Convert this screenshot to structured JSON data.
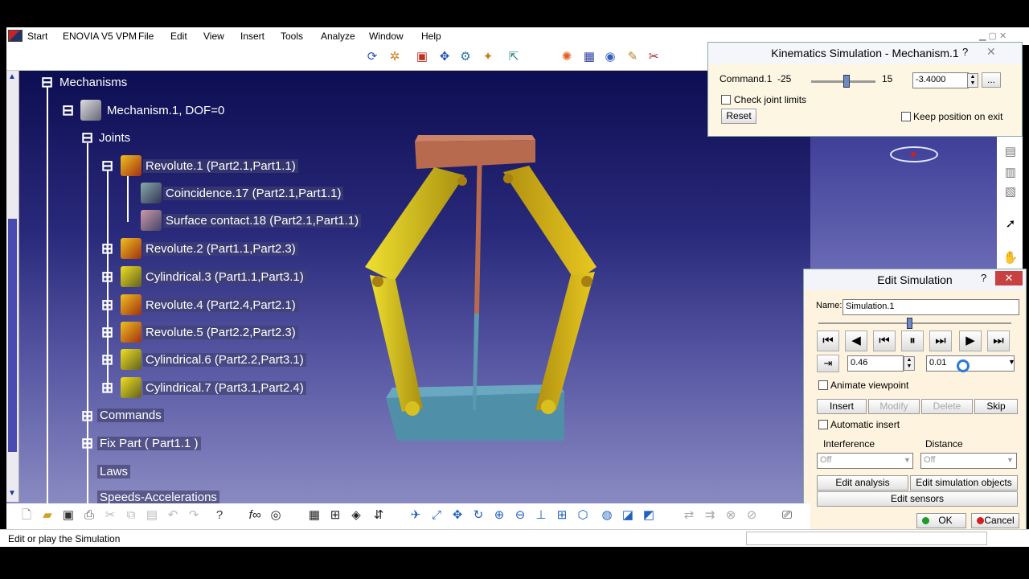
{
  "menu": {
    "start": "Start",
    "items": [
      "ENOVIA V5 VPM",
      "File",
      "Edit",
      "View",
      "Insert",
      "Tools",
      "Analyze",
      "Window",
      "Help"
    ]
  },
  "tree": {
    "root": "Mechanisms",
    "mechanism": "Mechanism.1, DOF=0",
    "joints": "Joints",
    "revolute1": "Revolute.1 (Part2.1,Part1.1)",
    "coincidence": "Coincidence.17 (Part2.1,Part1.1)",
    "surface": "Surface contact.18 (Part2.1,Part1.1)",
    "revolute2": "Revolute.2 (Part1.1,Part2.3)",
    "cyl3": "Cylindrical.3 (Part1.1,Part3.1)",
    "revolute4": "Revolute.4 (Part2.4,Part2.1)",
    "revolute5": "Revolute.5 (Part2.2,Part2.3)",
    "cyl6": "Cylindrical.6 (Part2.2,Part3.1)",
    "cyl7": "Cylindrical.7 (Part3.1,Part2.4)",
    "commands": "Commands",
    "fixpart": "Fix Part ( Part1.1 )",
    "laws": "Laws",
    "speeds": "Speeds-Accelerations"
  },
  "kinematics": {
    "title": "Kinematics Simulation - Mechanism.1",
    "help": "?",
    "close": "✕",
    "command_label": "Command.1",
    "min": "-25",
    "max": "15",
    "value": "-3.4000",
    "more": "...",
    "check_limits": "Check joint limits",
    "reset": "Reset",
    "keep_position": "Keep position on exit"
  },
  "editsim": {
    "title": "Edit Simulation",
    "help": "?",
    "close": "✕",
    "name_label": "Name:",
    "name_value": "Simulation.1",
    "step_value": "0.46",
    "speed_value": "0.01",
    "animate_viewpoint": "Animate viewpoint",
    "insert": "Insert",
    "modify": "Modify",
    "delete": "Delete",
    "skip": "Skip",
    "automatic_insert": "Automatic insert",
    "interference_label": "Interference",
    "interference_value": "Off",
    "distance_label": "Distance",
    "distance_value": "Off",
    "edit_analysis": "Edit analysis",
    "edit_objects": "Edit simulation objects",
    "edit_sensors": "Edit sensors",
    "ok": "OK",
    "cancel": "Cancel"
  },
  "status": {
    "message": "Edit or play the Simulation"
  },
  "colors": {
    "yellow_link": "#d6c21a",
    "base": "#4f8fa8",
    "top_plate": "#b86a4e"
  }
}
